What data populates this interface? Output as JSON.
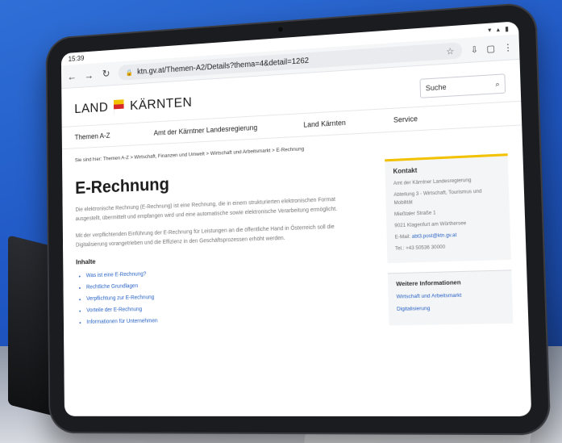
{
  "status_bar": {
    "time": "15:39"
  },
  "browser": {
    "url": "ktn.gv.at/Themen-A2/Details?thema=4&detail=1262"
  },
  "site": {
    "logo_left": "LAND",
    "logo_right": "KÄRNTEN",
    "search_label": "Suche",
    "menu": [
      "Themen A-Z",
      "Amt der Kärntner Landesregierung",
      "Land Kärnten",
      "Service"
    ],
    "breadcrumb": "Sie sind hier: Themen A-Z > Wirtschaft, Finanzen und Umwelt > Wirtschaft und Arbeitsmarkt > E-Rechnung"
  },
  "article": {
    "title": "E-Rechnung",
    "paragraph1": "Die elektronische Rechnung (E-Rechnung) ist eine Rechnung, die in einem strukturierten elektronischen Format ausgestellt, übermittelt und empfangen wird und eine automatische sowie elektronische Verarbeitung ermöglicht.",
    "paragraph2": "Mit der verpflichtenden Einführung der E-Rechnung für Leistungen an die öffentliche Hand in Österreich soll die Digitalisierung vorangetrieben und die Effizienz in den Geschäftsprozessen erhöht werden.",
    "toc_heading": "Inhalte",
    "toc": [
      "Was ist eine E-Rechnung?",
      "Rechtliche Grundlagen",
      "Verpflichtung zur E-Rechnung",
      "Vorteile der E-Rechnung",
      "Informationen für Unternehmen"
    ]
  },
  "sidebar": {
    "contact_heading": "Kontakt",
    "contact_lines": [
      "Amt der Kärntner Landesregierung",
      "Abteilung 3 - Wirtschaft, Tourismus und Mobilität",
      "Mießtaler Straße 1",
      "9021 Klagenfurt am Wörthersee"
    ],
    "email_label": "E-Mail:",
    "email": "abt3.post@ktn.gv.at",
    "phone": "Tel.: +43 50536 30000",
    "more_heading": "Weitere Informationen",
    "more_links": [
      "Wirtschaft und Arbeitsmarkt",
      "Digitalisierung"
    ]
  }
}
